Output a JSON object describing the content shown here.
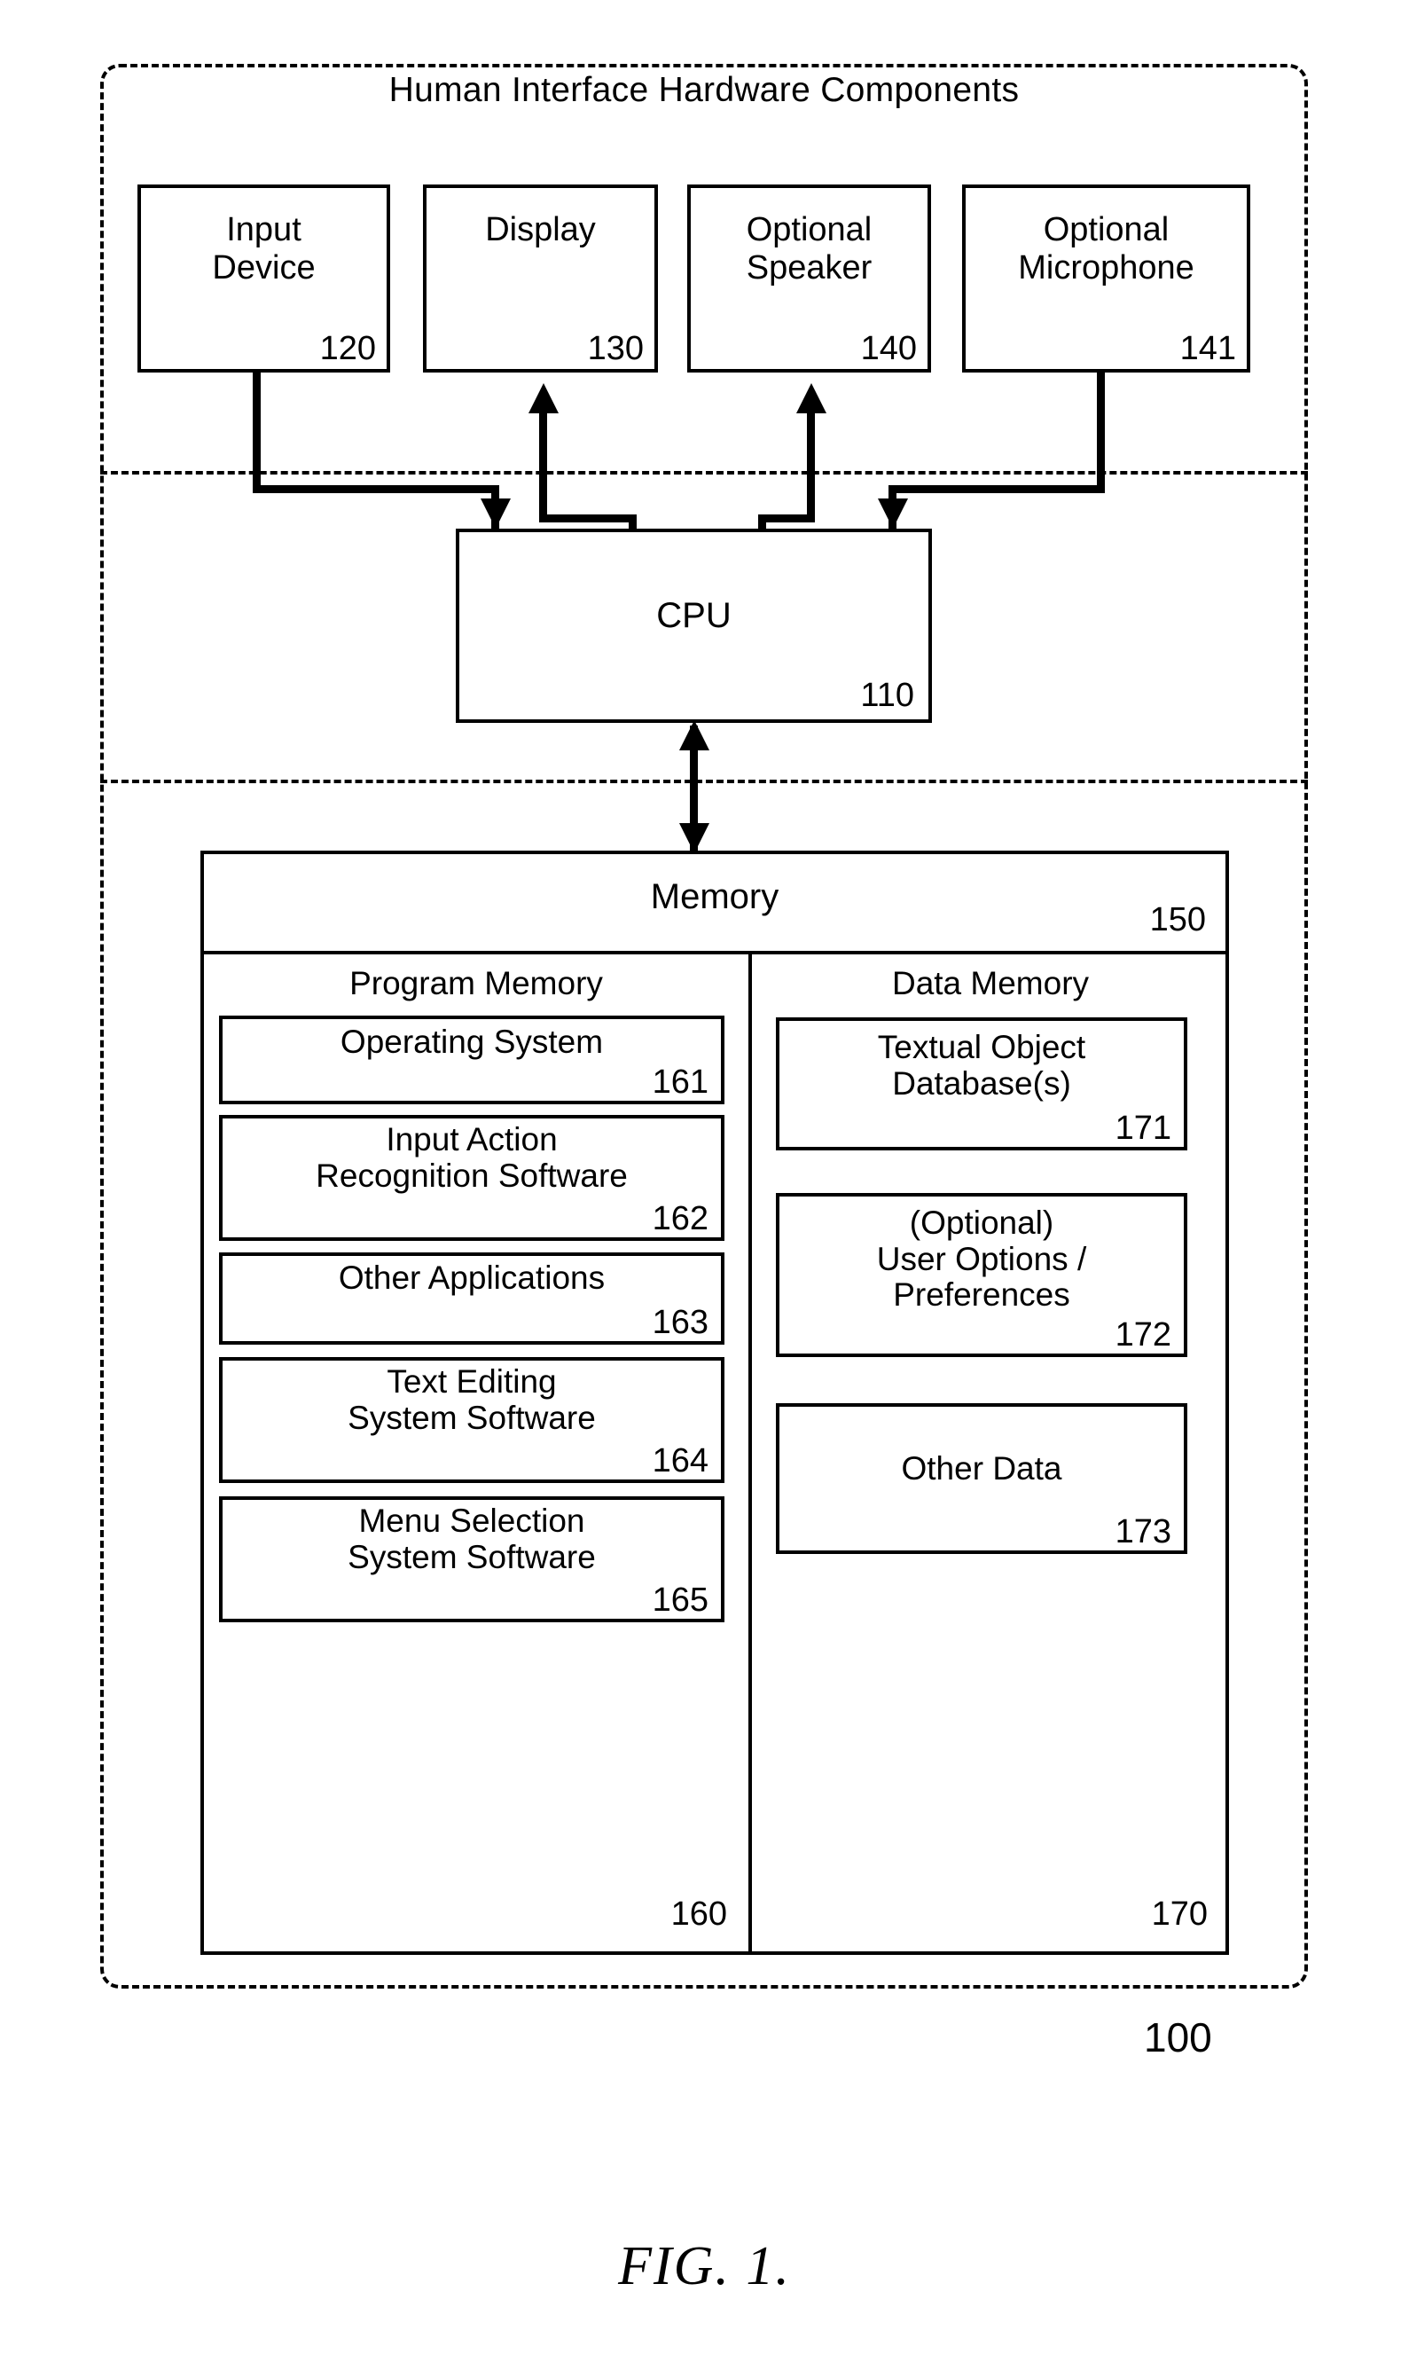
{
  "figure": {
    "caption": "FIG. 1.",
    "system_ref": "100"
  },
  "hardware_section": {
    "title": "Human Interface Hardware Components",
    "boxes": [
      {
        "label": "Input\nDevice",
        "ref": "120",
        "name": "input-device"
      },
      {
        "label": "Display",
        "ref": "130",
        "name": "display"
      },
      {
        "label": "Optional\nSpeaker",
        "ref": "140",
        "name": "optional-speaker"
      },
      {
        "label": "Optional\nMicrophone",
        "ref": "141",
        "name": "optional-microphone"
      }
    ]
  },
  "cpu": {
    "label": "CPU",
    "ref": "110"
  },
  "memory": {
    "title": "Memory",
    "ref": "150",
    "program_memory": {
      "title": "Program Memory",
      "ref": "160",
      "items": [
        {
          "label": "Operating System",
          "ref": "161"
        },
        {
          "label": "Input Action\nRecognition Software",
          "ref": "162"
        },
        {
          "label": "Other Applications",
          "ref": "163"
        },
        {
          "label": "Text Editing\nSystem Software",
          "ref": "164"
        },
        {
          "label": "Menu Selection\nSystem Software",
          "ref": "165"
        }
      ]
    },
    "data_memory": {
      "title": "Data Memory",
      "ref": "170",
      "items": [
        {
          "label": "Textual Object\nDatabase(s)",
          "ref": "171"
        },
        {
          "label": "(Optional)\nUser Options /\nPreferences",
          "ref": "172"
        },
        {
          "label": "Other Data",
          "ref": "173"
        }
      ]
    }
  },
  "colors": {
    "ink": "#000000",
    "paper": "#ffffff"
  }
}
